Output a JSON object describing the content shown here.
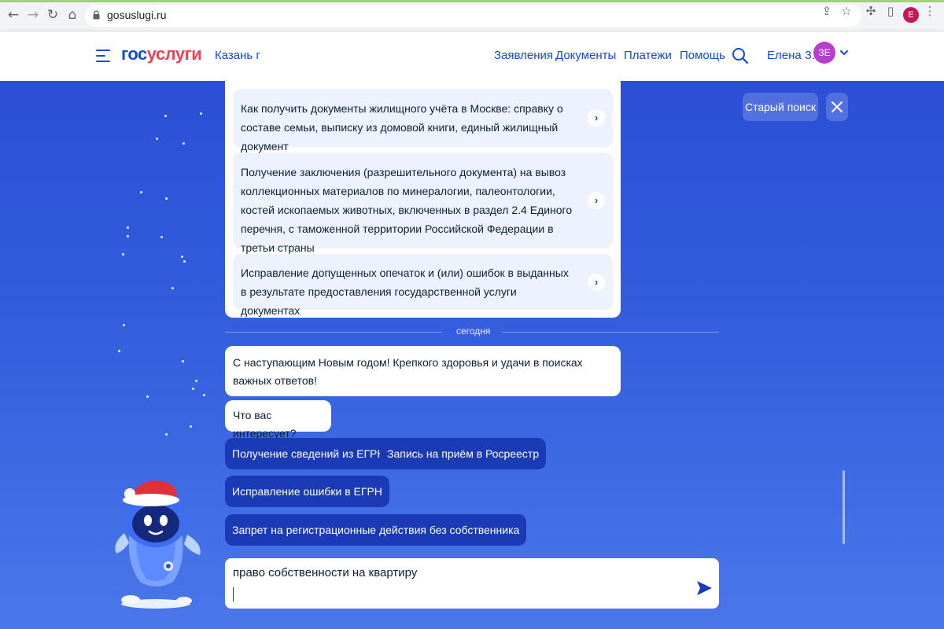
{
  "browser": {
    "url": "gosuslugi.ru",
    "profile_letter": "E"
  },
  "header": {
    "logo_part1": "гос",
    "logo_part2": "услуги",
    "city": "Казань г",
    "menu": [
      "Заявления",
      "Документы",
      "Платежи",
      "Помощь"
    ],
    "user_name": "Елена З.",
    "avatar_initials": "ЗЕ"
  },
  "cards": [
    {
      "text": "Как получить документы жилищного учёта в Москве: справку о составе семьи, выписку из домовой книги, единый жилищный документ"
    },
    {
      "text": "Получение заключения (разрешительного документа) на вывоз коллекционных материалов по минералогии, палеонтологии, костей ископаемых животных, включенных в раздел 2.4 Единого перечня, с таможенной территории Российской Федерации в третьи страны"
    },
    {
      "text": "Исправление допущенных опечаток и (или) ошибок в выданных в результате предоставления государственной услуги документах"
    }
  ],
  "chat": {
    "day_separator": "сегодня",
    "greeting": "С наступающим Новым годом! Крепкого здоровья и удачи в поисках важных ответов!",
    "question": "Что вас интересует?",
    "chips": [
      "Получение сведений из ЕГРН",
      "Запись на приём в Росреестр",
      "Исправление ошибки в ЕГРН",
      "Запрет на регистрационные действия без собственника"
    ],
    "input_value": "право собственности на квартиру"
  },
  "side": {
    "old_search_label": "Старый поиск"
  },
  "colors": {
    "brand_blue": "#0d4cd3",
    "brand_red": "#ee3f58",
    "chip_bg": "#1b3ab6",
    "page_bg": "#2d52d8"
  }
}
